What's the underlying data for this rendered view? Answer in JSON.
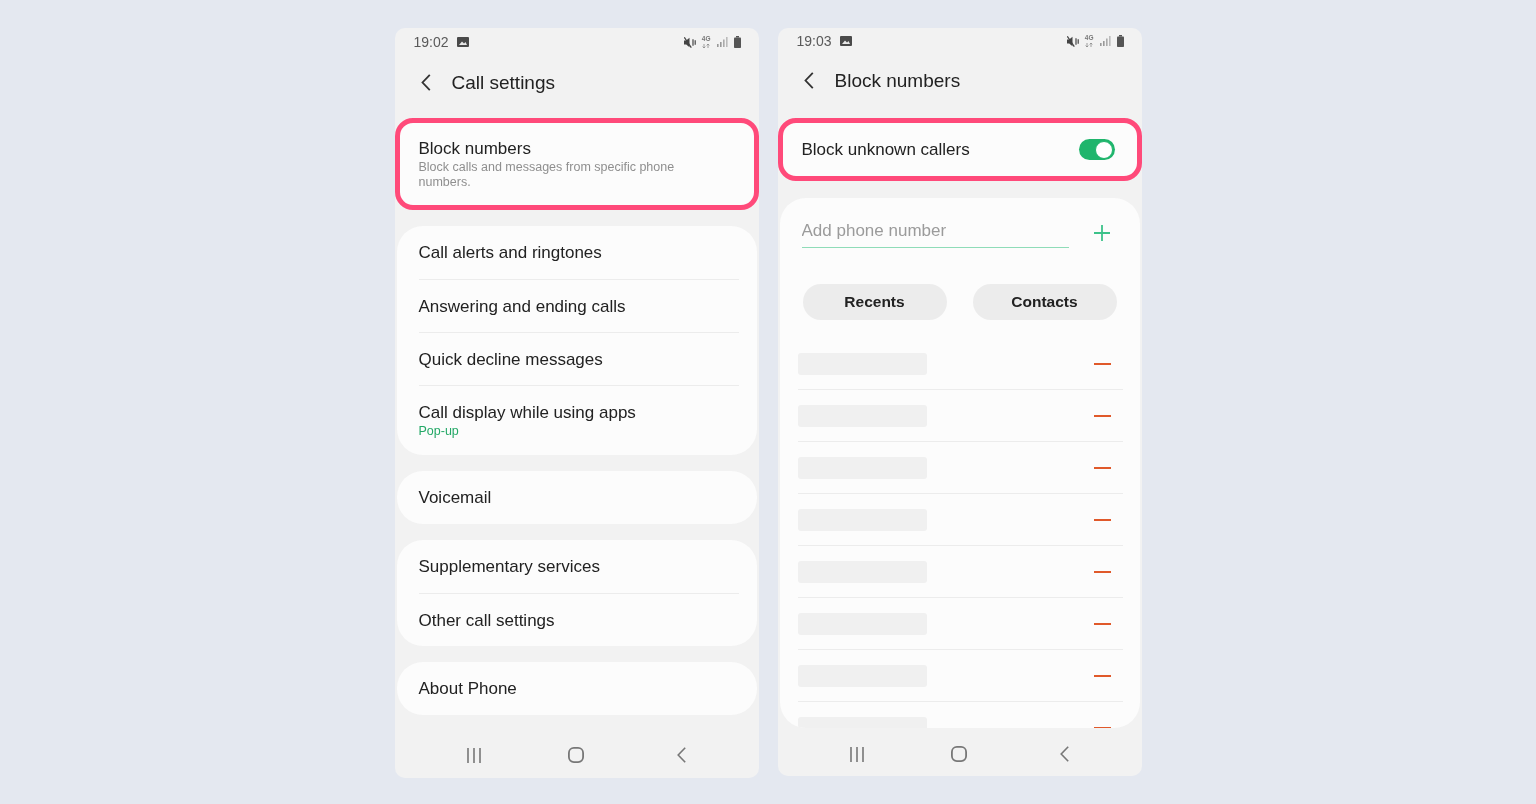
{
  "screens": [
    {
      "kind": "settings",
      "status_bar": {
        "time": "19:02",
        "network": "4G"
      },
      "header": {
        "title": "Call settings"
      },
      "groups": [
        {
          "highlighted": true,
          "items": [
            {
              "title": "Block numbers",
              "description": "Block calls and messages from specific phone numbers."
            }
          ]
        },
        {
          "highlighted": false,
          "items": [
            {
              "title": "Call alerts and ringtones"
            },
            {
              "title": "Answering and ending calls"
            },
            {
              "title": "Quick decline messages"
            },
            {
              "title": "Call display while using apps",
              "value": "Pop-up"
            }
          ]
        },
        {
          "highlighted": false,
          "items": [
            {
              "title": "Voicemail"
            }
          ]
        },
        {
          "highlighted": false,
          "items": [
            {
              "title": "Supplementary services"
            },
            {
              "title": "Other call settings"
            }
          ]
        },
        {
          "highlighted": false,
          "items": [
            {
              "title": "About Phone"
            }
          ]
        }
      ]
    },
    {
      "kind": "block_numbers",
      "status_bar": {
        "time": "19:03",
        "network": "4G"
      },
      "header": {
        "title": "Block numbers"
      },
      "toggle_item": {
        "title": "Block unknown callers",
        "on": true,
        "highlighted": true
      },
      "add_field": {
        "placeholder": "Add phone number"
      },
      "buttons": [
        "Recents",
        "Contacts"
      ],
      "blocked_numbers": [
        {
          "redacted": true
        },
        {
          "redacted": true
        },
        {
          "redacted": true
        },
        {
          "redacted": true
        },
        {
          "redacted": true
        },
        {
          "redacted": true
        },
        {
          "redacted": true
        },
        {
          "redacted": true
        }
      ]
    }
  ]
}
